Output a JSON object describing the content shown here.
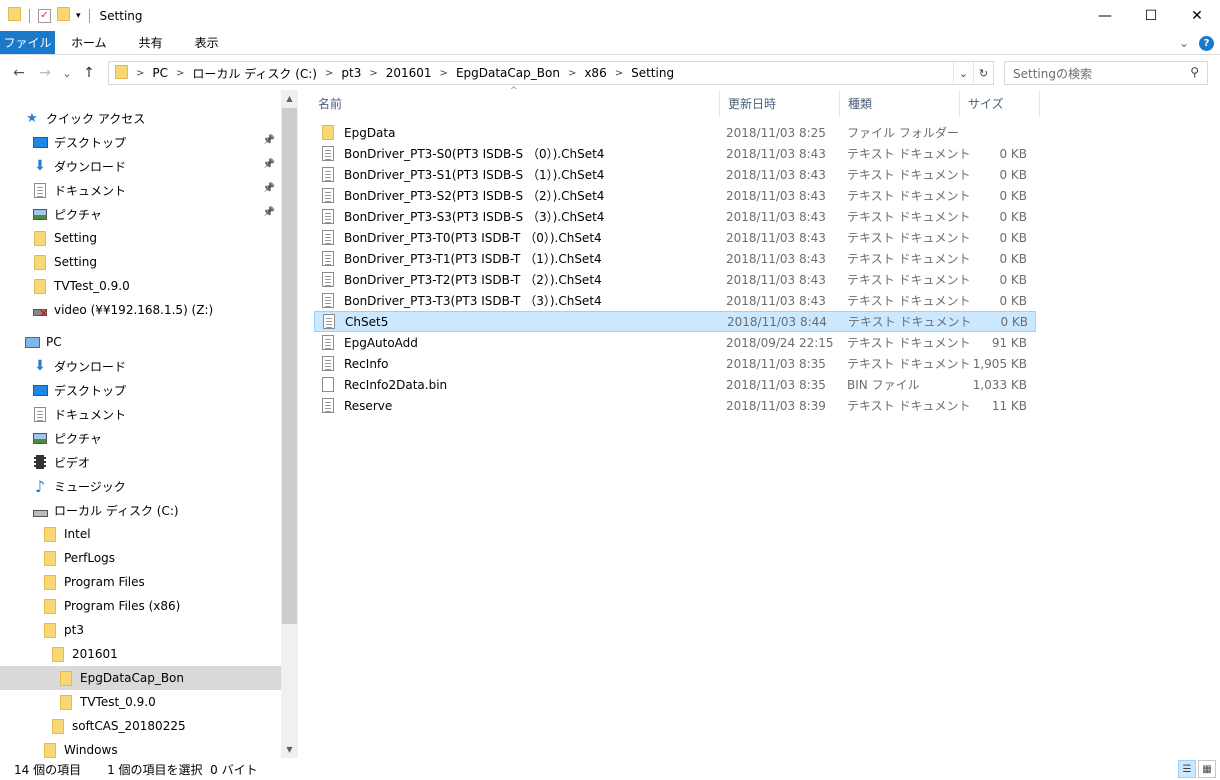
{
  "window": {
    "title": "Setting",
    "controls": {
      "minimize": "—",
      "maximize": "☐",
      "close": "✕"
    }
  },
  "ribbon": {
    "tabs": [
      "ファイル",
      "ホーム",
      "共有",
      "表示"
    ],
    "expand_glyph": "⌄",
    "help_glyph": "?"
  },
  "nav": {
    "back": "←",
    "forward": "→",
    "recent": "⌄",
    "up": "↑"
  },
  "address": {
    "crumbs": [
      "PC",
      "ローカル ディスク (C:)",
      "pt3",
      "201601",
      "EpgDataCap_Bon",
      "x86",
      "Setting"
    ],
    "dropdown_glyph": "⌄",
    "refresh_glyph": "↻"
  },
  "search": {
    "placeholder": "Settingの検索"
  },
  "sidebar": {
    "items": [
      {
        "label": "クイック アクセス",
        "icon": "star-icon",
        "indent": 0,
        "pin": false
      },
      {
        "label": "デスクトップ",
        "icon": "desktop-icon",
        "indent": 1,
        "pin": true
      },
      {
        "label": "ダウンロード",
        "icon": "download-icon",
        "indent": 1,
        "pin": true
      },
      {
        "label": "ドキュメント",
        "icon": "documents-icon",
        "indent": 1,
        "pin": true
      },
      {
        "label": "ピクチャ",
        "icon": "pictures-icon",
        "indent": 1,
        "pin": true
      },
      {
        "label": "Setting",
        "icon": "folder-icon",
        "indent": 1,
        "pin": false
      },
      {
        "label": "Setting",
        "icon": "folder-icon",
        "indent": 1,
        "pin": false
      },
      {
        "label": "TVTest_0.9.0",
        "icon": "folder-icon",
        "indent": 1,
        "pin": false
      },
      {
        "label": "video (¥¥192.168.1.5) (Z:)",
        "icon": "network-drive-disconnected-icon",
        "indent": 1,
        "pin": false
      },
      {
        "label": "PC",
        "icon": "pc-icon",
        "indent": 0,
        "pin": false,
        "gap": true
      },
      {
        "label": "ダウンロード",
        "icon": "download-icon",
        "indent": 1,
        "pin": false
      },
      {
        "label": "デスクトップ",
        "icon": "desktop-icon",
        "indent": 1,
        "pin": false
      },
      {
        "label": "ドキュメント",
        "icon": "documents-icon",
        "indent": 1,
        "pin": false
      },
      {
        "label": "ピクチャ",
        "icon": "pictures-icon",
        "indent": 1,
        "pin": false
      },
      {
        "label": "ビデオ",
        "icon": "videos-icon",
        "indent": 1,
        "pin": false
      },
      {
        "label": "ミュージック",
        "icon": "music-icon",
        "indent": 1,
        "pin": false
      },
      {
        "label": "ローカル ディスク (C:)",
        "icon": "drive-icon",
        "indent": 1,
        "pin": false
      },
      {
        "label": "Intel",
        "icon": "folder-icon",
        "indent": 2,
        "pin": false
      },
      {
        "label": "PerfLogs",
        "icon": "folder-icon",
        "indent": 2,
        "pin": false
      },
      {
        "label": "Program Files",
        "icon": "folder-icon",
        "indent": 2,
        "pin": false
      },
      {
        "label": "Program Files (x86)",
        "icon": "folder-icon",
        "indent": 2,
        "pin": false
      },
      {
        "label": "pt3",
        "icon": "folder-icon",
        "indent": 2,
        "pin": false
      },
      {
        "label": "201601",
        "icon": "folder-icon",
        "indent": 3,
        "pin": false
      },
      {
        "label": "EpgDataCap_Bon",
        "icon": "folder-icon",
        "indent": 4,
        "pin": false,
        "selected": true
      },
      {
        "label": "TVTest_0.9.0",
        "icon": "folder-icon",
        "indent": 4,
        "pin": false
      },
      {
        "label": "softCAS_20180225",
        "icon": "folder-icon",
        "indent": 3,
        "pin": false
      },
      {
        "label": "Windows",
        "icon": "folder-icon",
        "indent": 2,
        "pin": false
      }
    ]
  },
  "filelist": {
    "columns": {
      "name": "名前",
      "date": "更新日時",
      "type": "種類",
      "size": "サイズ"
    },
    "sort_glyph": "^",
    "rows": [
      {
        "name": "EpgData",
        "date": "2018/11/03 8:25",
        "type": "ファイル フォルダー",
        "size": "",
        "icon": "folder-icon"
      },
      {
        "name": "BonDriver_PT3-S0(PT3 ISDB-S （0）).ChSet4",
        "date": "2018/11/03 8:43",
        "type": "テキスト ドキュメント",
        "size": "0 KB",
        "icon": "text-document-icon"
      },
      {
        "name": "BonDriver_PT3-S1(PT3 ISDB-S （1）).ChSet4",
        "date": "2018/11/03 8:43",
        "type": "テキスト ドキュメント",
        "size": "0 KB",
        "icon": "text-document-icon"
      },
      {
        "name": "BonDriver_PT3-S2(PT3 ISDB-S （2）).ChSet4",
        "date": "2018/11/03 8:43",
        "type": "テキスト ドキュメント",
        "size": "0 KB",
        "icon": "text-document-icon"
      },
      {
        "name": "BonDriver_PT3-S3(PT3 ISDB-S （3）).ChSet4",
        "date": "2018/11/03 8:43",
        "type": "テキスト ドキュメント",
        "size": "0 KB",
        "icon": "text-document-icon"
      },
      {
        "name": "BonDriver_PT3-T0(PT3 ISDB-T （0）).ChSet4",
        "date": "2018/11/03 8:43",
        "type": "テキスト ドキュメント",
        "size": "0 KB",
        "icon": "text-document-icon"
      },
      {
        "name": "BonDriver_PT3-T1(PT3 ISDB-T （1）).ChSet4",
        "date": "2018/11/03 8:43",
        "type": "テキスト ドキュメント",
        "size": "0 KB",
        "icon": "text-document-icon"
      },
      {
        "name": "BonDriver_PT3-T2(PT3 ISDB-T （2）).ChSet4",
        "date": "2018/11/03 8:43",
        "type": "テキスト ドキュメント",
        "size": "0 KB",
        "icon": "text-document-icon"
      },
      {
        "name": "BonDriver_PT3-T3(PT3 ISDB-T （3）).ChSet4",
        "date": "2018/11/03 8:43",
        "type": "テキスト ドキュメント",
        "size": "0 KB",
        "icon": "text-document-icon"
      },
      {
        "name": "ChSet5",
        "date": "2018/11/03 8:44",
        "type": "テキスト ドキュメント",
        "size": "0 KB",
        "icon": "text-document-icon",
        "selected": true
      },
      {
        "name": "EpgAutoAdd",
        "date": "2018/09/24 22:15",
        "type": "テキスト ドキュメント",
        "size": "91 KB",
        "icon": "text-document-icon"
      },
      {
        "name": "RecInfo",
        "date": "2018/11/03 8:35",
        "type": "テキスト ドキュメント",
        "size": "1,905 KB",
        "icon": "text-document-icon"
      },
      {
        "name": "RecInfo2Data.bin",
        "date": "2018/11/03 8:35",
        "type": "BIN ファイル",
        "size": "1,033 KB",
        "icon": "blank-file-icon"
      },
      {
        "name": "Reserve",
        "date": "2018/11/03 8:39",
        "type": "テキスト ドキュメント",
        "size": "11 KB",
        "icon": "text-document-icon"
      }
    ]
  },
  "status": {
    "item_count": "14 個の項目",
    "selection": "1 個の項目を選択  0 バイト"
  },
  "colors": {
    "accent": "#1979ca",
    "selection_bg": "#cce8ff",
    "selection_border": "#99d1ff",
    "nav_selected_bg": "#d9d9d9",
    "folder_yellow": "#f8d775"
  }
}
